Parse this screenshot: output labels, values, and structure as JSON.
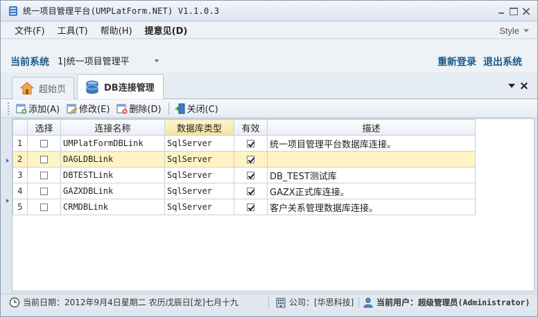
{
  "window": {
    "title": "统一项目管理平台(UMPLatForm.NET) V1.1.0.3"
  },
  "menu": {
    "items": [
      {
        "label": "文件(F)"
      },
      {
        "label": "工具(T)"
      },
      {
        "label": "帮助(H)"
      },
      {
        "label": "提意见(D)"
      }
    ],
    "style_label": "Style"
  },
  "system": {
    "label": "当前系统",
    "selected": "1|统一项目管理平",
    "relogin": "重新登录",
    "exit": "退出系统"
  },
  "tabs": [
    {
      "label": "超始页",
      "icon": "home-icon",
      "active": false
    },
    {
      "label": "DB连接管理",
      "icon": "database-icon",
      "active": true
    }
  ],
  "toolbar": {
    "add": "添加(A)",
    "edit": "修改(E)",
    "delete": "删除(D)",
    "close": "关闭(C)"
  },
  "grid": {
    "columns": [
      "选择",
      "连接名称",
      "数据库类型",
      "有效",
      "描述"
    ],
    "sorted_column": "数据库类型",
    "selected_row": 2,
    "rows": [
      {
        "num": "1",
        "checked": false,
        "name": "UMPlatFormDBLink",
        "dbtype": "SqlServer",
        "valid": true,
        "desc": "统一项目管理平台数据库连接。"
      },
      {
        "num": "2",
        "checked": false,
        "name": "DAGLDBLink",
        "dbtype": "SqlServer",
        "valid": true,
        "desc": ""
      },
      {
        "num": "3",
        "checked": false,
        "name": "DBTESTLink",
        "dbtype": "SqlServer",
        "valid": true,
        "desc": "DB_TEST测试库"
      },
      {
        "num": "4",
        "checked": false,
        "name": "GAZXDBLink",
        "dbtype": "SqlServer",
        "valid": true,
        "desc": "GAZX正式库连接。"
      },
      {
        "num": "5",
        "checked": false,
        "name": "CRMDBLink",
        "dbtype": "SqlServer",
        "valid": true,
        "desc": "客户关系管理数据库连接。"
      }
    ]
  },
  "status": {
    "date": "当前日期：2012年9月4日星期二 农历戊辰日[龙]七月十九",
    "company": "公司：[华思科技]",
    "user_label": "当前用户：",
    "user": "超级管理员(Administrator)"
  },
  "colors": {
    "accent": "#1a5a8a",
    "selected_row": "#fff3c4",
    "sorted_header": "#f3e2a0"
  }
}
